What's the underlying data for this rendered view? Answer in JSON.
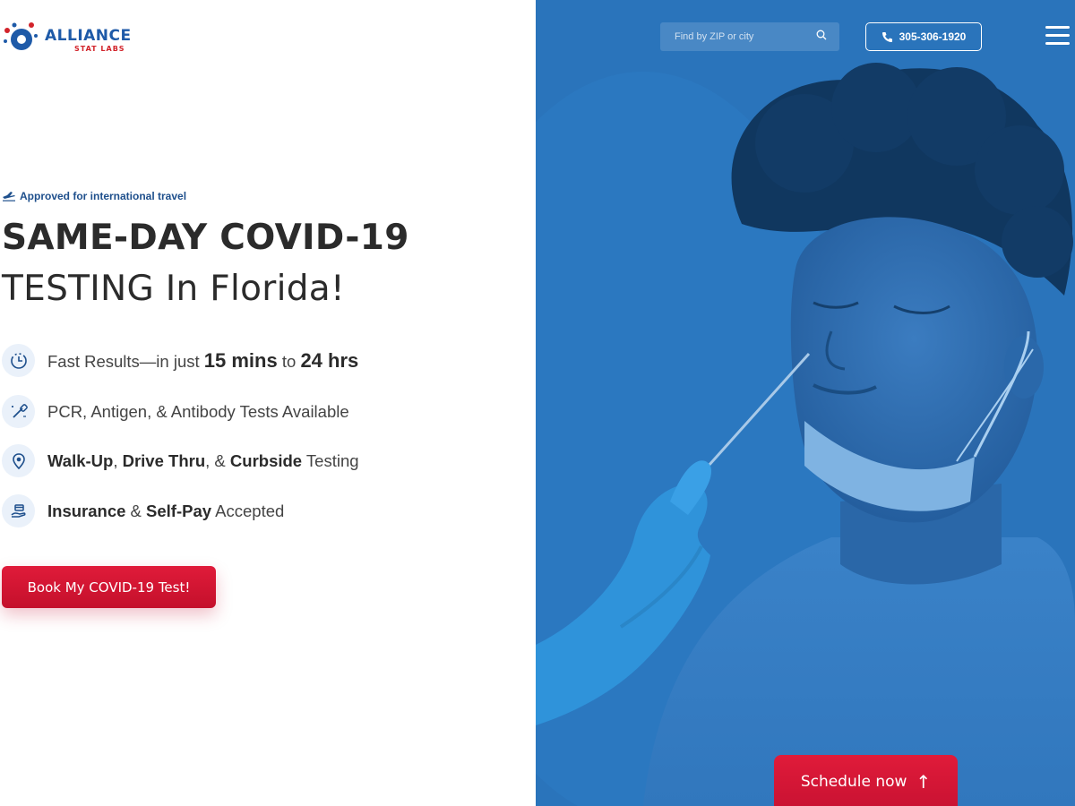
{
  "brand": {
    "name": "ALLIANCE",
    "sub": "STAT LABS",
    "primary_color": "#1e5aa8",
    "accent_color": "#d2232a"
  },
  "header": {
    "search_placeholder": "Find by ZIP or city",
    "phone": "305-306-1920",
    "menu_icon": "hamburger-menu-icon"
  },
  "hero": {
    "badge": "Approved for international travel",
    "title_line1": "SAME-DAY COVID-19",
    "title_line2": "TESTING In Florida!",
    "features": [
      {
        "icon": "clock-icon",
        "parts": [
          "Fast Results—in just ",
          "15 mins",
          " to ",
          "24 hrs"
        ]
      },
      {
        "icon": "swab-icon",
        "parts": [
          "PCR, Antigen, & Antibody Tests Available"
        ]
      },
      {
        "icon": "location-pin-icon",
        "parts": [
          "Walk-Up",
          ", ",
          "Drive Thru",
          ", & ",
          "Curbside",
          " Testing"
        ]
      },
      {
        "icon": "hand-card-icon",
        "parts": [
          "Insurance",
          " & ",
          "Self-Pay",
          " Accepted"
        ]
      }
    ],
    "cta": "Book My COVID-19 Test!"
  },
  "schedule": {
    "label": "Schedule now",
    "icon": "arrow-up-icon"
  }
}
